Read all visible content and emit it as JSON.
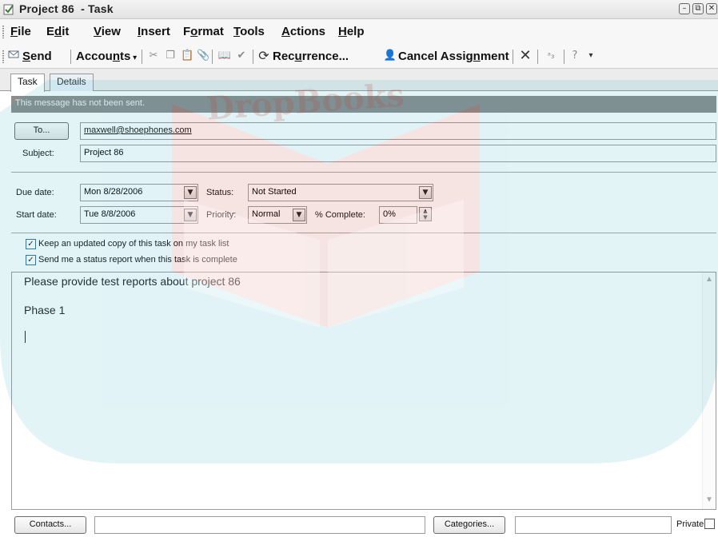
{
  "window": {
    "title": "Project 86  - Task",
    "controls": {
      "minimize": "–",
      "restore": "⧉",
      "close": "✕"
    }
  },
  "menu": {
    "items": [
      {
        "mnemonic": "F",
        "rest": "ile"
      },
      {
        "pre": "E",
        "mnemonic": "d",
        "rest": "it",
        "mnemonic_first": false
      },
      {
        "mnemonic": "V",
        "rest": "iew"
      },
      {
        "mnemonic": "I",
        "rest": "nsert"
      },
      {
        "pre": "F",
        "mnemonic": "o",
        "rest": "rmat"
      },
      {
        "mnemonic": "T",
        "rest": "ools"
      },
      {
        "mnemonic": "A",
        "rest": "ctions"
      },
      {
        "mnemonic": "H",
        "rest": "elp"
      }
    ]
  },
  "toolbar": {
    "send_mnemonic": "S",
    "send_rest": "end",
    "accounts_pre": "Accou",
    "accounts_mnemonic": "n",
    "accounts_rest": "ts",
    "recurrence_pre": "Rec",
    "recurrence_mnemonic": "u",
    "recurrence_rest": "rrence...",
    "cancel_pre": "Cancel Assig",
    "cancel_mnemonic": "n",
    "cancel_rest": "ment",
    "icons": [
      "cut-icon",
      "copy-icon",
      "paste-icon",
      "attach-icon",
      "address-book-icon",
      "check-names-icon",
      "recurrence-icon",
      "cancel-assignment-icon",
      "delete-icon",
      "spelling-icon",
      "help-icon",
      "overflow-icon"
    ]
  },
  "tabs": {
    "task": "Task",
    "details": "Details"
  },
  "info_bar": "This message has not been sent.",
  "form": {
    "to_button": "To...",
    "to_value": "maxwell@shoephones.com",
    "subject_label": "Subject:",
    "subject_value": "Project 86",
    "due_label": "Due date:",
    "due_value": "Mon 8/28/2006",
    "start_label": "Start date:",
    "start_value": "Tue 8/8/2006",
    "status_label": "Status:",
    "status_value": "Not Started",
    "priority_label": "Priority:",
    "priority_value": "Normal",
    "complete_label": "% Complete:",
    "complete_value": "0%",
    "keep_copy_label": "Keep an updated copy of this task on my task list",
    "keep_copy_checked": true,
    "status_report_label": "Send me a status report when this task is complete",
    "status_report_checked": true
  },
  "body": {
    "lines": [
      "Please provide test reports about project 86",
      "Phase 1"
    ]
  },
  "footer": {
    "contacts_button": "Contacts...",
    "contacts_value": "",
    "categories_button": "Categories...",
    "categories_value": "",
    "private_label": "Private",
    "private_checked": false
  },
  "watermark_text": "DropBooks",
  "colors": {
    "info_bar": "#8d8d8d",
    "watermark_teal": "#29a8c4",
    "watermark_red": "#c0392b"
  }
}
